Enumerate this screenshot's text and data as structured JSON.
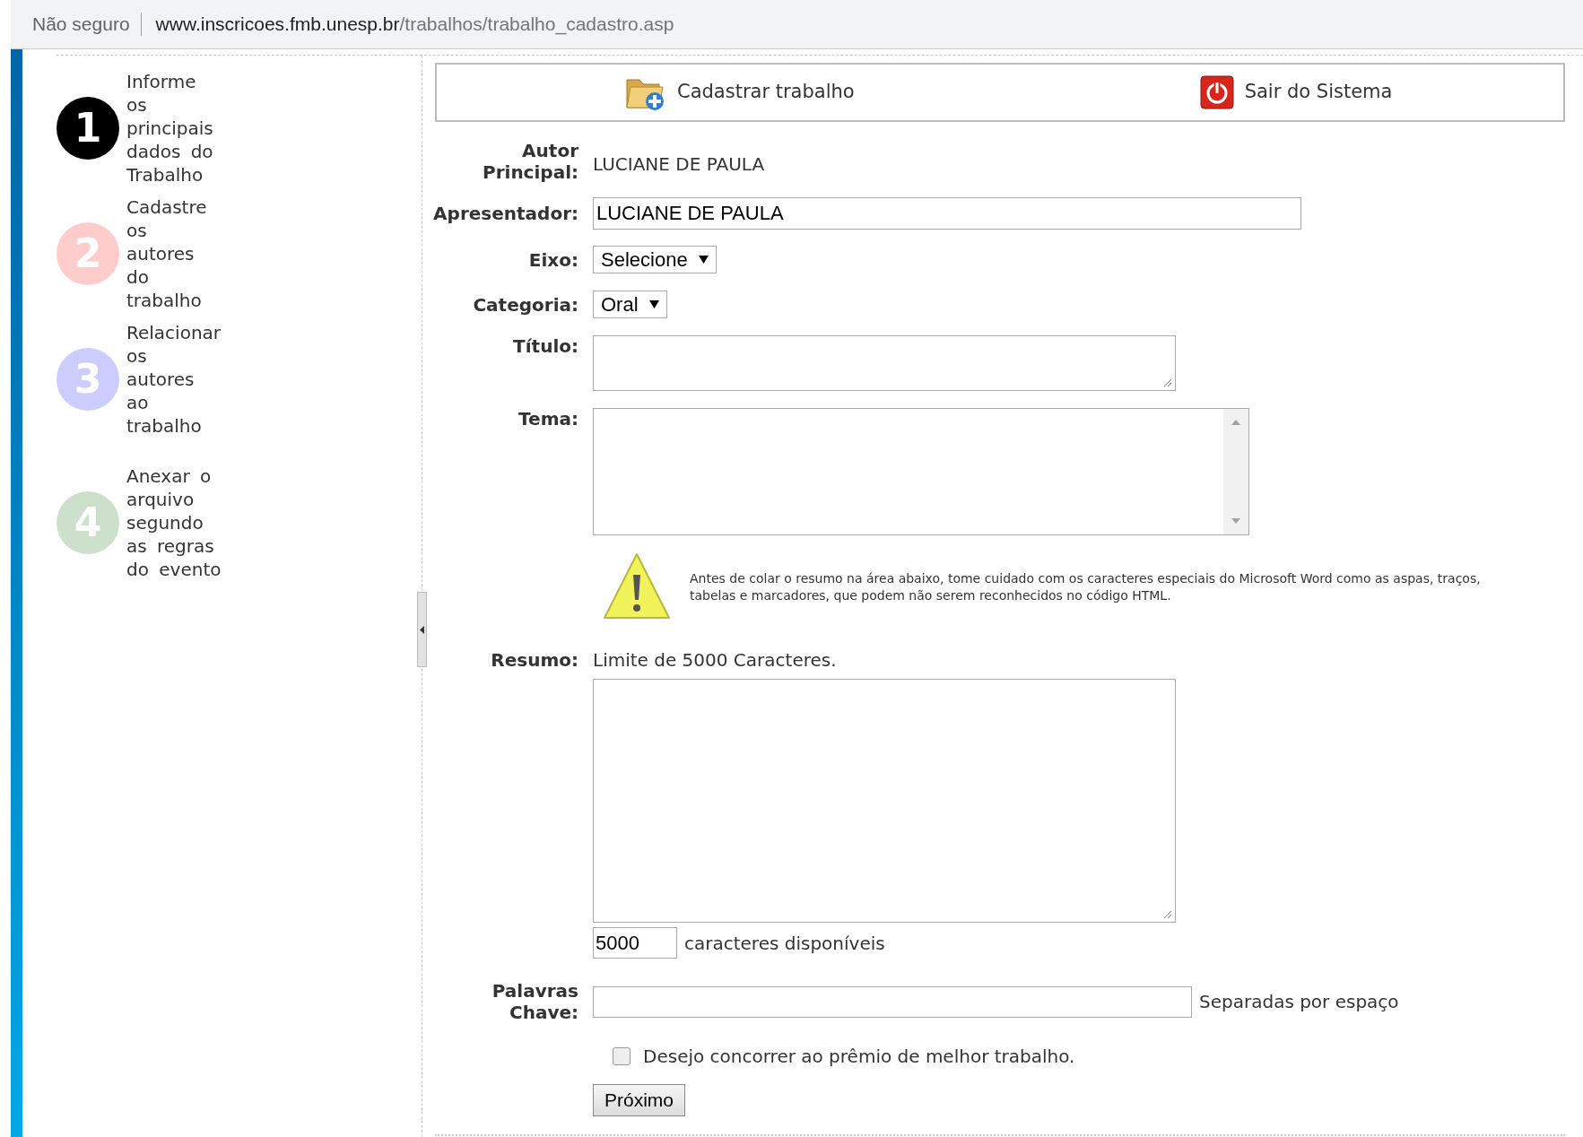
{
  "address_bar": {
    "security": "Não seguro",
    "host": "www.inscricoes.fmb.unesp.br",
    "path": "/trabalhos/trabalho_cadastro.asp"
  },
  "steps": [
    {
      "number": "1",
      "text": "Informe os principais dados do Trabalho",
      "color": "#000000"
    },
    {
      "number": "2",
      "text": "Cadastre os autores do trabalho",
      "color": "#ffcccc"
    },
    {
      "number": "3",
      "text": "Relacionar os autores ao trabalho",
      "color": "#ccccff"
    },
    {
      "number": "4",
      "text": "Anexar o arquivo segundo as regras do evento",
      "color": "#cce0cc"
    }
  ],
  "toolbar": [
    {
      "kind": "add",
      "label": "Cadastrar trabalho"
    },
    {
      "kind": "exit",
      "label": "Sair do Sistema"
    }
  ],
  "form": {
    "autor_principal": {
      "label": "Autor Principal:",
      "value": "LUCIANE DE PAULA"
    },
    "apresentador": {
      "label": "Apresentador:",
      "value": "LUCIANE DE PAULA"
    },
    "eixo": {
      "label": "Eixo:",
      "value": "Selecione"
    },
    "categoria": {
      "label": "Categoria:",
      "value": "Oral"
    },
    "titulo": {
      "label": "Título:"
    },
    "tema": {
      "label": "Tema:"
    },
    "warning": "Antes de colar o resumo na área abaixo, tome cuidado com os caracteres especiais do Microsoft Word como as aspas, traços, tabelas e marcadores, que podem não serem reconhecidos no código HTML.",
    "resumo": {
      "label": "Resumo:",
      "hint": "Limite de 5000 Caracteres.",
      "counter": "5000",
      "counter_label": "caracteres disponíveis"
    },
    "palavras_chave": {
      "label": "Palavras Chave:",
      "hint": "Separadas por espaço"
    },
    "premio": {
      "label": "Desejo concorrer ao prêmio de melhor trabalho.",
      "checked": false
    },
    "submit": "Próximo"
  }
}
